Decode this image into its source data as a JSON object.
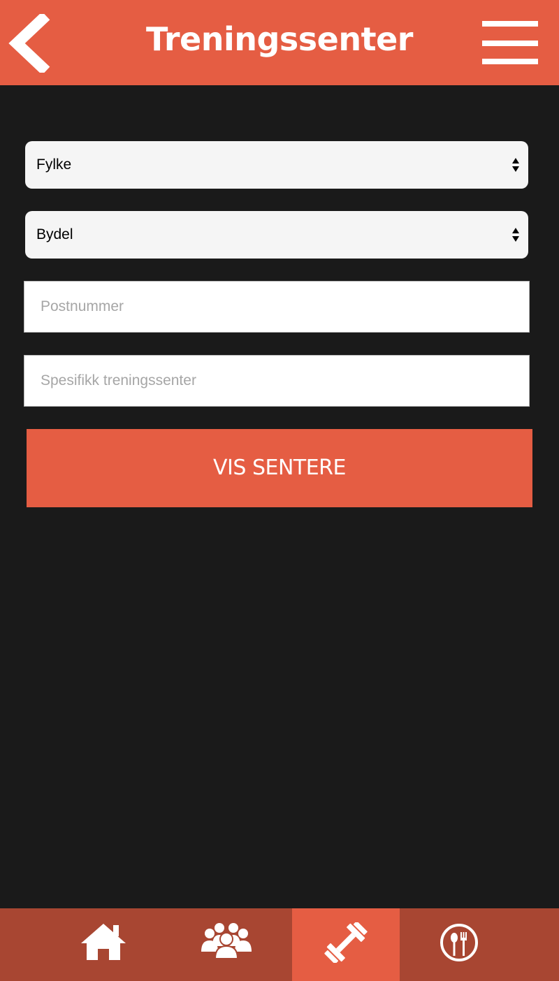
{
  "header": {
    "title": "Treningssenter",
    "back_icon": "chevron-left-icon",
    "menu_icon": "hamburger-menu-icon"
  },
  "form": {
    "county_select": {
      "value": "Fylke"
    },
    "district_select": {
      "value": "Bydel"
    },
    "postal_code_input": {
      "placeholder": "Postnummer",
      "value": ""
    },
    "gym_name_input": {
      "placeholder": "Spesifikk treningssenter",
      "value": ""
    },
    "submit_label": "VIS SENTERE"
  },
  "bottom_nav": {
    "items": [
      {
        "icon": "home-icon",
        "active": false
      },
      {
        "icon": "group-icon",
        "active": false
      },
      {
        "icon": "dumbbell-icon",
        "active": true
      },
      {
        "icon": "restaurant-icon",
        "active": false
      }
    ]
  },
  "colors": {
    "accent": "#e55d43",
    "nav_background": "#a84632",
    "page_background": "#1a1a1a"
  }
}
